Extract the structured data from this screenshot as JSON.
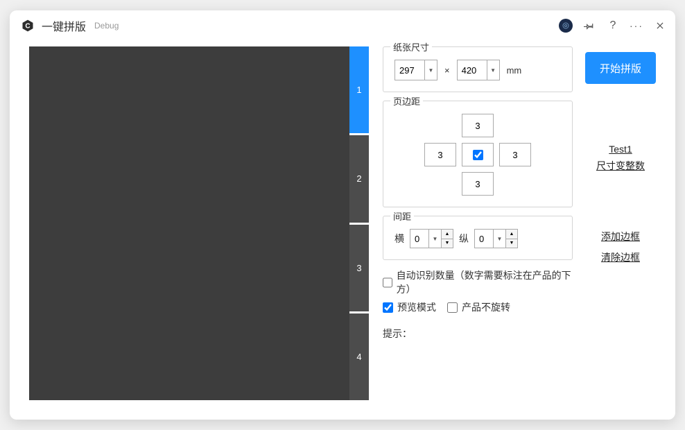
{
  "header": {
    "title": "一键拼版",
    "subtitle": "Debug"
  },
  "thumbs": [
    "1",
    "2",
    "3",
    "4"
  ],
  "active_thumb": 0,
  "paper": {
    "legend": "纸张尺寸",
    "width": "297",
    "height": "420",
    "times": "×",
    "unit": "mm"
  },
  "margins": {
    "legend": "页边距",
    "top": "3",
    "left": "3",
    "right": "3",
    "bottom": "3",
    "lock_checked": true
  },
  "spacing": {
    "legend": "间距",
    "h_label": "横",
    "h_value": "0",
    "v_label": "纵",
    "v_value": "0"
  },
  "checks": {
    "auto_label": "自动识别数量（数字需要标注在产品的下方）",
    "auto_checked": false,
    "preview_label": "预览模式",
    "preview_checked": true,
    "norotate_label": "产品不旋转",
    "norotate_checked": false
  },
  "hint_label": "提示：",
  "actions": {
    "start": "开始拼版",
    "test1": "Test1",
    "size_int": "尺寸变整数",
    "add_border": "添加边框",
    "clear_border": "清除边框"
  }
}
